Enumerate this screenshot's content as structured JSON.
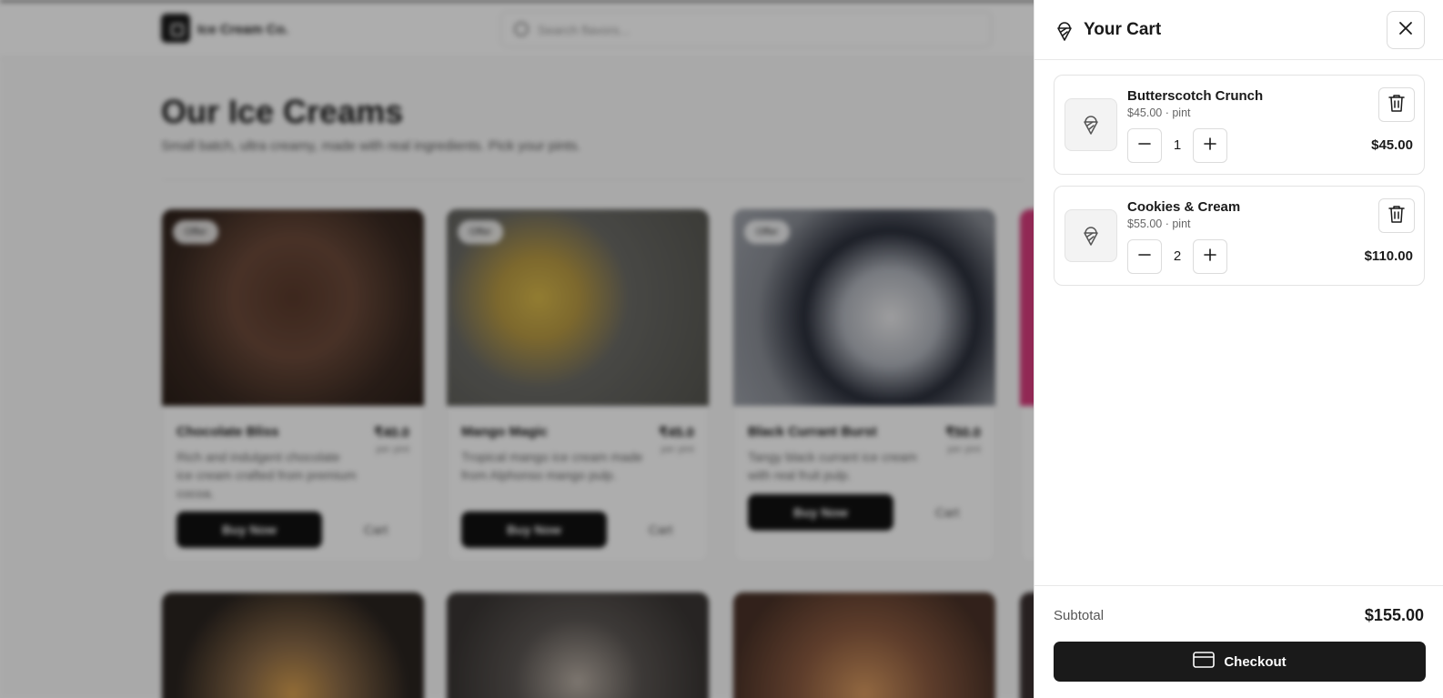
{
  "background": {
    "brand": "Ice Cream Co.",
    "search_placeholder": "Search flavors...",
    "title": "Our Ice Creams",
    "subtitle": "Small batch, ultra creamy, made with real ingredients. Pick your pints.",
    "products": [
      {
        "tag": "Offer",
        "name": "Chocolate Bliss",
        "price": "₹40.0",
        "per": "per pint",
        "desc": "Rich and indulgent chocolate ice cream crafted from premium cocoa.",
        "buy": "Buy Now",
        "cart": "Cart",
        "color": "#6b4a3a"
      },
      {
        "tag": "Offer",
        "name": "Mango Magic",
        "price": "₹45.0",
        "per": "per pint",
        "desc": "Tropical mango ice cream made from Alphonso mango pulp.",
        "buy": "Buy Now",
        "cart": "Cart",
        "color": "#8a8478"
      },
      {
        "tag": "Offer",
        "name": "Black Currant Burst",
        "price": "₹50.0",
        "per": "per pint",
        "desc": "Tangy black currant ice cream with real fruit pulp.",
        "buy": "Buy Now",
        "cart": "Cart",
        "color": "#9aa0a8"
      }
    ],
    "row2_colors": [
      "#6a5a48",
      "#5a5552",
      "#7a5a48"
    ]
  },
  "cart": {
    "title": "Your Cart",
    "close_icon": "close-icon",
    "items": [
      {
        "name": "Butterscotch Crunch",
        "meta": "$45.00 · pint",
        "qty": "1",
        "total": "$45.00"
      },
      {
        "name": "Cookies & Cream",
        "meta": "$55.00 · pint",
        "qty": "2",
        "total": "$110.00"
      }
    ],
    "subtotal_label": "Subtotal",
    "subtotal_value": "$155.00",
    "checkout_label": "Checkout"
  },
  "colors": {
    "accent": "#1a1a1a",
    "overlay": "rgba(0,0,0,0.32)",
    "pink_card": "#d63c7c"
  }
}
